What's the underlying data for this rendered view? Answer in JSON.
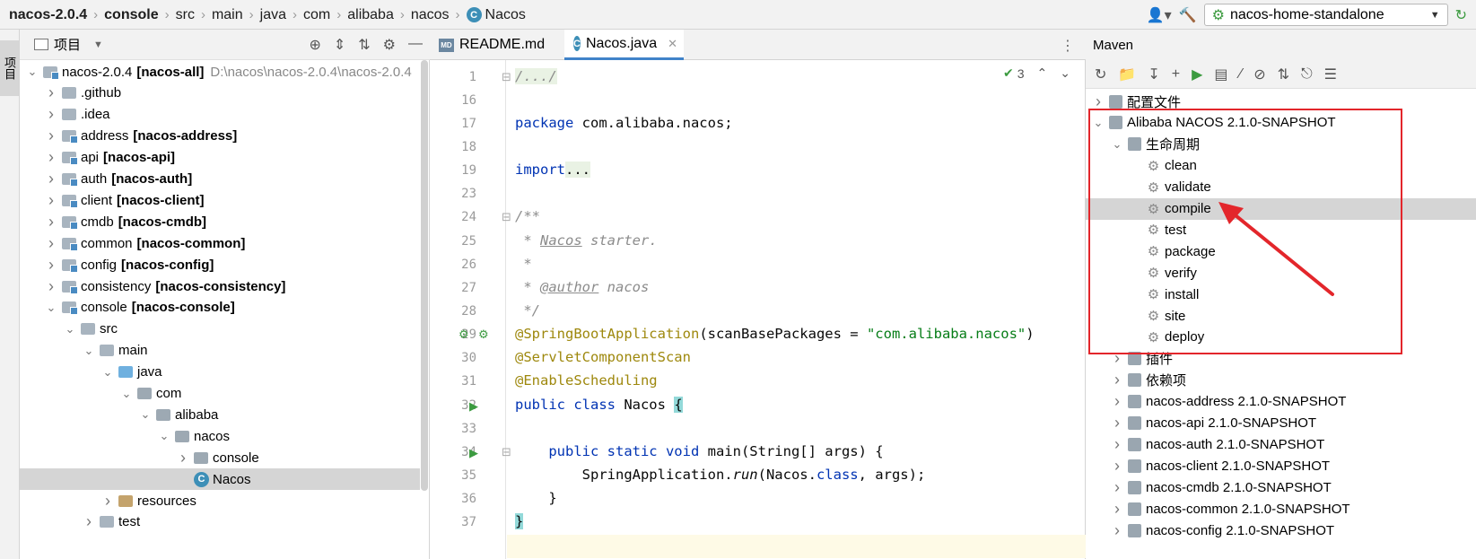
{
  "breadcrumb": [
    "nacos-2.0.4",
    "console",
    "src",
    "main",
    "java",
    "com",
    "alibaba",
    "nacos",
    "Nacos"
  ],
  "run_config": {
    "label": "nacos-home-standalone"
  },
  "left_stripe": {
    "project_tab": "项目"
  },
  "project": {
    "title": "项目",
    "tree": [
      {
        "label": "nacos-2.0.4",
        "module": "[nacos-all]",
        "hint": "D:\\nacos\\nacos-2.0.4\\nacos-2.0.4",
        "indent": 0,
        "expanded": true,
        "icon": "module-folder-icon"
      },
      {
        "label": ".github",
        "module": "",
        "hint": "",
        "indent": 1,
        "expanded": false,
        "icon": "folder-icon"
      },
      {
        "label": ".idea",
        "module": "",
        "hint": "",
        "indent": 1,
        "expanded": false,
        "icon": "folder-icon"
      },
      {
        "label": "address",
        "module": "[nacos-address]",
        "hint": "",
        "indent": 1,
        "expanded": false,
        "icon": "module-folder-icon"
      },
      {
        "label": "api",
        "module": "[nacos-api]",
        "hint": "",
        "indent": 1,
        "expanded": false,
        "icon": "module-folder-icon"
      },
      {
        "label": "auth",
        "module": "[nacos-auth]",
        "hint": "",
        "indent": 1,
        "expanded": false,
        "icon": "module-folder-icon"
      },
      {
        "label": "client",
        "module": "[nacos-client]",
        "hint": "",
        "indent": 1,
        "expanded": false,
        "icon": "module-folder-icon"
      },
      {
        "label": "cmdb",
        "module": "[nacos-cmdb]",
        "hint": "",
        "indent": 1,
        "expanded": false,
        "icon": "module-folder-icon"
      },
      {
        "label": "common",
        "module": "[nacos-common]",
        "hint": "",
        "indent": 1,
        "expanded": false,
        "icon": "module-folder-icon"
      },
      {
        "label": "config",
        "module": "[nacos-config]",
        "hint": "",
        "indent": 1,
        "expanded": false,
        "icon": "module-folder-icon"
      },
      {
        "label": "consistency",
        "module": "[nacos-consistency]",
        "hint": "",
        "indent": 1,
        "expanded": false,
        "icon": "module-folder-icon"
      },
      {
        "label": "console",
        "module": "[nacos-console]",
        "hint": "",
        "indent": 1,
        "expanded": true,
        "icon": "module-folder-icon"
      },
      {
        "label": "src",
        "module": "",
        "hint": "",
        "indent": 2,
        "expanded": true,
        "icon": "folder-icon"
      },
      {
        "label": "main",
        "module": "",
        "hint": "",
        "indent": 3,
        "expanded": true,
        "icon": "folder-icon"
      },
      {
        "label": "java",
        "module": "",
        "hint": "",
        "indent": 4,
        "expanded": true,
        "icon": "source-folder-icon"
      },
      {
        "label": "com",
        "module": "",
        "hint": "",
        "indent": 5,
        "expanded": true,
        "icon": "package-icon"
      },
      {
        "label": "alibaba",
        "module": "",
        "hint": "",
        "indent": 6,
        "expanded": true,
        "icon": "package-icon"
      },
      {
        "label": "nacos",
        "module": "",
        "hint": "",
        "indent": 7,
        "expanded": true,
        "icon": "package-icon"
      },
      {
        "label": "console",
        "module": "",
        "hint": "",
        "indent": 8,
        "expanded": false,
        "icon": "package-icon"
      },
      {
        "label": "Nacos",
        "module": "",
        "hint": "",
        "indent": 8,
        "expanded": null,
        "icon": "java-class-icon",
        "selected": true
      },
      {
        "label": "resources",
        "module": "",
        "hint": "",
        "indent": 4,
        "expanded": false,
        "icon": "resources-folder-icon"
      },
      {
        "label": "test",
        "module": "",
        "hint": "",
        "indent": 3,
        "expanded": false,
        "icon": "folder-icon"
      }
    ]
  },
  "editor": {
    "tabs": [
      {
        "label": "README.md",
        "active": false,
        "icon": "markdown-icon"
      },
      {
        "label": "Nacos.java",
        "active": true,
        "icon": "java-class-icon"
      }
    ],
    "inspection_count": "3",
    "line_numbers": [
      "1",
      "16",
      "17",
      "18",
      "19",
      "23",
      "24",
      "25",
      "26",
      "27",
      "28",
      "29",
      "30",
      "31",
      "32",
      "33",
      "34",
      "35",
      "36",
      "37"
    ],
    "code": {
      "l1": "/.../",
      "l17_kw": "package",
      "l17_rest": " com.alibaba.nacos;",
      "l19_kw": "import",
      "l19_rest": "...",
      "l24": "/**",
      "l25_a": " * ",
      "l25_b": "Nacos",
      "l25_c": " starter.",
      "l26": " *",
      "l27_a": " * ",
      "l27_b": "@author",
      "l27_c": " nacos",
      "l28": " */",
      "l29_ann": "@SpringBootApplication",
      "l29_a": "(scanBasePackages = ",
      "l29_str": "\"com.alibaba.nacos\"",
      "l29_b": ")",
      "l30": "@ServletComponentScan",
      "l31": "@EnableScheduling",
      "l32_kw": "public class",
      "l32_name": " Nacos ",
      "l32_brace": "{",
      "l34_kw": "    public static void",
      "l34_rest": " main(String[] args) {",
      "l35_a": "        SpringApplication.",
      "l35_run": "run",
      "l35_b": "(Nacos.",
      "l35_kw": "class",
      "l35_c": ", args);",
      "l36": "    }",
      "l37": "}"
    }
  },
  "maven": {
    "title": "Maven",
    "items": [
      {
        "label": "配置文件",
        "indent": 1,
        "expanded": false,
        "icon": "profiles-icon"
      },
      {
        "label": "Alibaba NACOS 2.1.0-SNAPSHOT",
        "indent": 1,
        "expanded": true,
        "icon": "maven-module-icon"
      },
      {
        "label": "生命周期",
        "indent": 2,
        "expanded": true,
        "icon": "lifecycle-icon"
      },
      {
        "label": "clean",
        "indent": 3,
        "expanded": null,
        "icon": "gear-icon"
      },
      {
        "label": "validate",
        "indent": 3,
        "expanded": null,
        "icon": "gear-icon"
      },
      {
        "label": "compile",
        "indent": 3,
        "expanded": null,
        "icon": "gear-icon",
        "selected": true
      },
      {
        "label": "test",
        "indent": 3,
        "expanded": null,
        "icon": "gear-icon"
      },
      {
        "label": "package",
        "indent": 3,
        "expanded": null,
        "icon": "gear-icon"
      },
      {
        "label": "verify",
        "indent": 3,
        "expanded": null,
        "icon": "gear-icon"
      },
      {
        "label": "install",
        "indent": 3,
        "expanded": null,
        "icon": "gear-icon"
      },
      {
        "label": "site",
        "indent": 3,
        "expanded": null,
        "icon": "gear-icon"
      },
      {
        "label": "deploy",
        "indent": 3,
        "expanded": null,
        "icon": "gear-icon"
      },
      {
        "label": "插件",
        "indent": 2,
        "expanded": false,
        "icon": "plugins-icon"
      },
      {
        "label": "依赖项",
        "indent": 2,
        "expanded": false,
        "icon": "dependencies-icon"
      },
      {
        "label": "nacos-address 2.1.0-SNAPSHOT",
        "indent": 2,
        "expanded": false,
        "icon": "maven-module-icon"
      },
      {
        "label": "nacos-api 2.1.0-SNAPSHOT",
        "indent": 2,
        "expanded": false,
        "icon": "maven-module-icon"
      },
      {
        "label": "nacos-auth 2.1.0-SNAPSHOT",
        "indent": 2,
        "expanded": false,
        "icon": "maven-module-icon"
      },
      {
        "label": "nacos-client 2.1.0-SNAPSHOT",
        "indent": 2,
        "expanded": false,
        "icon": "maven-module-icon"
      },
      {
        "label": "nacos-cmdb 2.1.0-SNAPSHOT",
        "indent": 2,
        "expanded": false,
        "icon": "maven-module-icon"
      },
      {
        "label": "nacos-common 2.1.0-SNAPSHOT",
        "indent": 2,
        "expanded": false,
        "icon": "maven-module-icon"
      },
      {
        "label": "nacos-config 2.1.0-SNAPSHOT",
        "indent": 2,
        "expanded": false,
        "icon": "maven-module-icon"
      }
    ]
  },
  "colors": {
    "highlight_box": "#e3262b",
    "selection": "#d5d5d5",
    "accent": "#4083c9"
  }
}
